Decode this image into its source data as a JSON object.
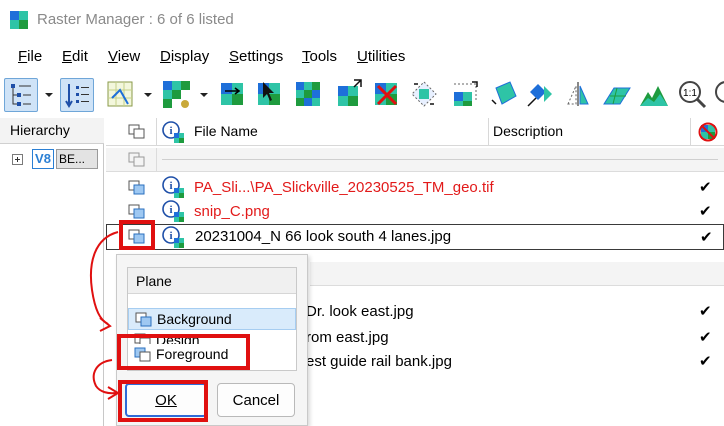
{
  "window": {
    "title": "Raster Manager : 6 of 6 listed"
  },
  "menu": [
    {
      "label": "File",
      "key": "F",
      "rest": "ile"
    },
    {
      "label": "Edit",
      "key": "E",
      "rest": "dit"
    },
    {
      "label": "View",
      "key": "V",
      "rest": "iew"
    },
    {
      "label": "Display",
      "key": "D",
      "rest": "isplay"
    },
    {
      "label": "Settings",
      "key": "S",
      "rest": "ettings"
    },
    {
      "label": "Tools",
      "key": "T",
      "rest": "ools"
    },
    {
      "label": "Utilities",
      "key": "U",
      "rest": "tilities"
    }
  ],
  "hierarchy": {
    "header": "Hierarchy",
    "node_badge": "V8",
    "node_label": "BE..."
  },
  "grid": {
    "columns": {
      "file_name": "File Name",
      "description": "Description"
    },
    "rows": [
      {
        "name": "PA_Sli...\\PA_Slickville_20230525_TM_geo.tif",
        "red": true,
        "checked": "✔"
      },
      {
        "name": "snip_C.png",
        "red": true,
        "checked": "✔"
      },
      {
        "name": "20231004_N 66 look south 4 lanes.jpg",
        "red": false,
        "checked": "✔",
        "selected": true
      },
      {
        "name": "Dr. look east.jpg",
        "red": false,
        "checked": "✔"
      },
      {
        "name": "rom east.jpg",
        "red": false,
        "checked": "✔"
      },
      {
        "name": "est guide rail bank.jpg",
        "red": false,
        "checked": "✔"
      }
    ]
  },
  "plane_popup": {
    "header": "Plane",
    "options": [
      "Background",
      "Design",
      "Foreground"
    ],
    "highlighted": "Background",
    "ok_label": "OK",
    "cancel_label": "Cancel"
  },
  "colors": {
    "annotation": "#e01010",
    "red_text": "#e21a1a",
    "accent": "#2f6bd8"
  }
}
